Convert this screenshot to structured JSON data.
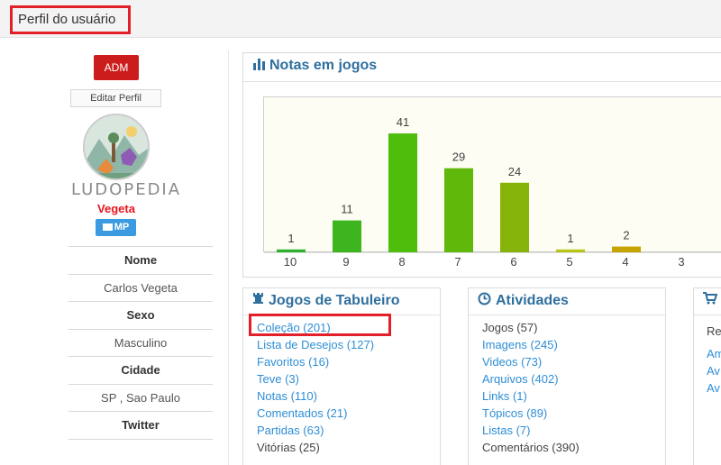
{
  "header": {
    "title": "Perfil do usuário"
  },
  "profile": {
    "role_badge": "ADM",
    "edit_label": "Editar Perfil",
    "logo_text": "LUDOPEDIA",
    "username": "Vegeta",
    "mp_label": "MP",
    "info": [
      {
        "label": "Nome",
        "value": "Carlos Vegeta"
      },
      {
        "label": "Sexo",
        "value": "Masculino"
      },
      {
        "label": "Cidade",
        "value": "SP , Sao Paulo"
      },
      {
        "label": "Twitter",
        "value": ""
      }
    ]
  },
  "chart_panel": {
    "title": "Notas em jogos"
  },
  "chart_data": {
    "type": "bar",
    "categories": [
      "10",
      "9",
      "8",
      "7",
      "6",
      "5",
      "4",
      "3"
    ],
    "values": [
      1,
      11,
      41,
      29,
      24,
      1,
      2,
      0
    ],
    "value_labels": [
      "1",
      "11",
      "41",
      "29",
      "24",
      "1",
      "2",
      ""
    ],
    "colors": [
      "#2eb22e",
      "#3db51f",
      "#4ebd0c",
      "#60b80a",
      "#86b40a",
      "#b8c417",
      "#c8a400",
      "#c8a400"
    ],
    "ylim": [
      0,
      46
    ],
    "grid": false,
    "legend": "none"
  },
  "jogos_panel": {
    "title": "Jogos de Tabuleiro",
    "items": [
      {
        "label": "Coleção (201)",
        "link": true
      },
      {
        "label": "Lista de Desejos (127)",
        "link": true
      },
      {
        "label": "Favoritos (16)",
        "link": true
      },
      {
        "label": "Teve (3)",
        "link": true
      },
      {
        "label": "Notas (110)",
        "link": true
      },
      {
        "label": "Comentados (21)",
        "link": true
      },
      {
        "label": "Partidas (63)",
        "link": true
      },
      {
        "label": "Vitórias (25)",
        "link": false
      }
    ]
  },
  "atividades_panel": {
    "title": "Atividades",
    "items": [
      {
        "label": "Jogos (57)",
        "link": false
      },
      {
        "label": "Imagens (245)",
        "link": true
      },
      {
        "label": "Videos (73)",
        "link": true
      },
      {
        "label": "Arquivos (402)",
        "link": true
      },
      {
        "label": "Links (1)",
        "link": true
      },
      {
        "label": "Tópicos (89)",
        "link": true
      },
      {
        "label": "Listas (7)",
        "link": true
      },
      {
        "label": "Comentários (390)",
        "link": false
      }
    ]
  },
  "third_panel": {
    "items": [
      {
        "label": "Re",
        "link": false
      },
      {
        "label": "Am",
        "link": true
      },
      {
        "label": "Av",
        "link": true
      },
      {
        "label": "Av",
        "link": true
      }
    ]
  },
  "colors": {
    "accent": "#2f6f9e",
    "link": "#2e8ed6",
    "highlight": "#e3202a",
    "danger": "#cc1d1d"
  }
}
